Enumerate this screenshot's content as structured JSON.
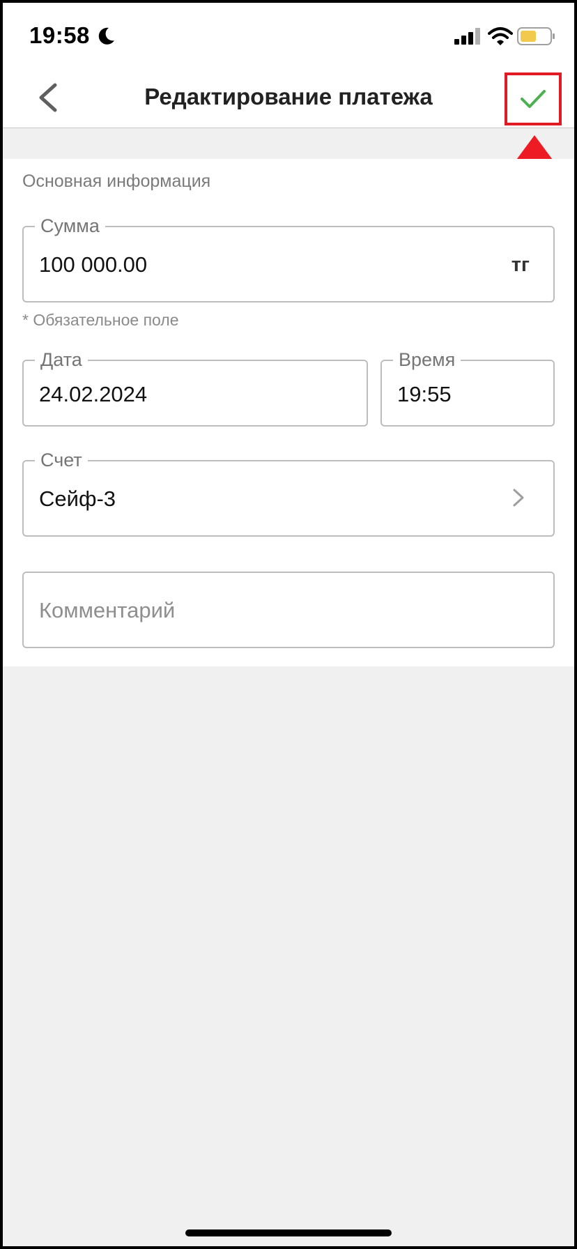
{
  "status_bar": {
    "time": "19:58",
    "icons": [
      "moon-icon",
      "cellular-signal-icon",
      "wifi-icon",
      "battery-icon"
    ],
    "battery_color": "#f2c94c"
  },
  "header": {
    "title": "Редактирование платежа",
    "back_icon": "chevron-left-icon",
    "confirm_icon": "checkmark-icon",
    "confirm_color": "#4caf50",
    "highlight_color": "#e01b24"
  },
  "form": {
    "section_title": "Основная информация",
    "amount": {
      "label": "Сумма",
      "value": "100 000.00",
      "unit": "тг"
    },
    "required_hint": "* Обязательное поле",
    "date": {
      "label": "Дата",
      "value": "24.02.2024"
    },
    "time": {
      "label": "Время",
      "value": "19:55"
    },
    "account": {
      "label": "Счет",
      "value": "Сейф-3"
    },
    "comment": {
      "placeholder": "Комментарий"
    }
  }
}
